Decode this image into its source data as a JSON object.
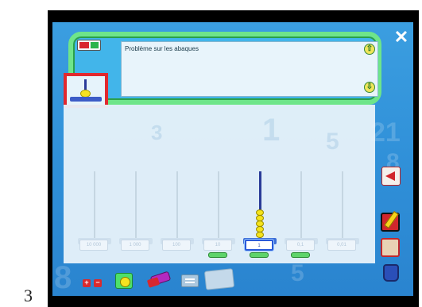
{
  "figure": {
    "number": "3"
  },
  "problem": {
    "text": "Problème sur les abaques"
  },
  "abacus": {
    "columns": [
      {
        "label": "10 000",
        "beads": 0,
        "active": false
      },
      {
        "label": "1 000",
        "beads": 0,
        "active": false
      },
      {
        "label": "100",
        "beads": 0,
        "active": false
      },
      {
        "label": "10",
        "beads": 0,
        "active": false
      },
      {
        "label": "1",
        "beads": 5,
        "active": true
      },
      {
        "label": "0,1",
        "beads": 0,
        "active": false
      },
      {
        "label": "0,01",
        "beads": 0,
        "active": false
      }
    ]
  },
  "colors": {
    "background": "#2f8fd8",
    "panel_border": "#6ee58a",
    "selected_border": "#e2282e",
    "bead": "#f5e31c",
    "rod_active": "#2a3b98"
  },
  "icons": {
    "close": "close-icon",
    "scroll_up": "arrow-up-icon",
    "scroll_down": "arrow-down-icon",
    "megaphone": "megaphone-icon",
    "notebook": "notebook-pencil-icon",
    "map": "map-book-icon",
    "trash": "trash-icon",
    "plus": "plus-icon",
    "minus": "minus-icon",
    "bead": "bead-icon",
    "eraser": "eraser-icon",
    "list": "list-icon",
    "card": "card-icon"
  },
  "glyphs": {
    "close": "✕",
    "up": "⇧",
    "down": "⇩",
    "plus": "+",
    "minus": "−"
  }
}
